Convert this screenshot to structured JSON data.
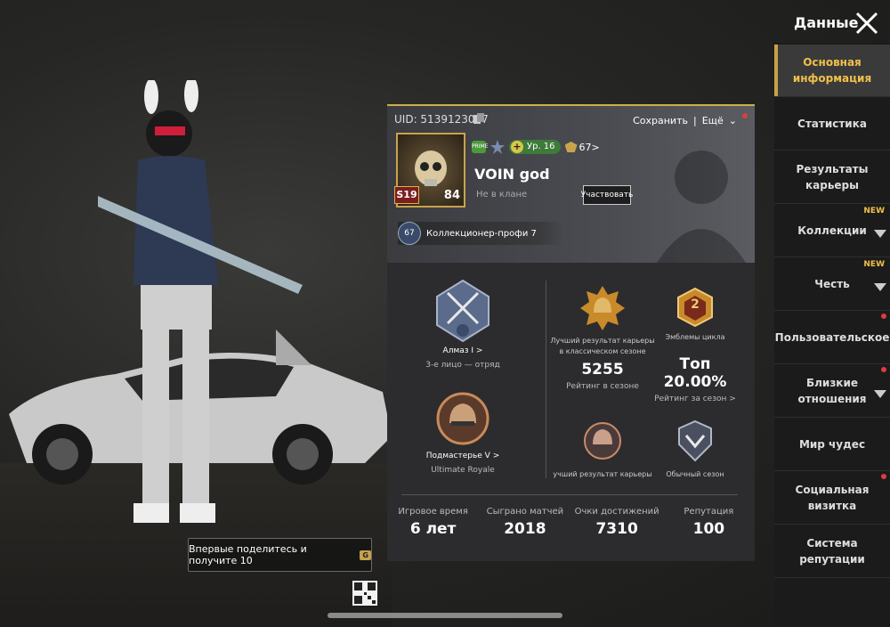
{
  "header": {
    "title": "Данные"
  },
  "profile": {
    "uid": "UID: 5139123027",
    "save_label": "Сохранить",
    "more_label": "Ещё",
    "avatar_level": "84",
    "season_badge": "S19",
    "player_level": "Ур. 16",
    "rank_points": "67>",
    "name": "VOIN god",
    "clan": "Не в клане",
    "join_label": "Участвовать",
    "collector_level": "67",
    "collector_title": "Коллекционер-профи 7"
  },
  "tiers": {
    "squad_tier": "Алмаз I  >",
    "squad_mode": "3-е лицо — отряд",
    "ur_tier": "Подмастерье V  >",
    "ur_mode": "Ultimate Royale",
    "best_career_label": "Лучший результат карьеры в классическом сезоне",
    "season_rating_value": "5255",
    "season_rating_label": "Рейтинг в сезоне",
    "cycle_emblems_label": "Эмблемы цикла",
    "cycle_badge_num": "2",
    "top_value": "Топ 20.00%",
    "top_label": "Рейтинг за сезон >",
    "best_career2_label": "учший результат карьеры",
    "normal_season_label": "Обычный сезон"
  },
  "stats": [
    {
      "label": "Игровое время",
      "value": "6 лет"
    },
    {
      "label": "Сыграно матчей",
      "value": "2018"
    },
    {
      "label": "Очки достижений",
      "value": "7310"
    },
    {
      "label": "Репутация",
      "value": "100"
    }
  ],
  "share": {
    "text": "Впервые поделитесь и получите 10"
  },
  "sidebar": {
    "new_label": "NEW",
    "items": [
      {
        "label": "Основная информация"
      },
      {
        "label": "Статистика"
      },
      {
        "label": "Результаты карьеры"
      },
      {
        "label": "Коллекции"
      },
      {
        "label": "Честь"
      },
      {
        "label": "Пользовательское"
      },
      {
        "label": "Близкие отношения"
      },
      {
        "label": "Мир чудес"
      },
      {
        "label": "Социальная визитка"
      },
      {
        "label": "Система репутации"
      }
    ]
  }
}
